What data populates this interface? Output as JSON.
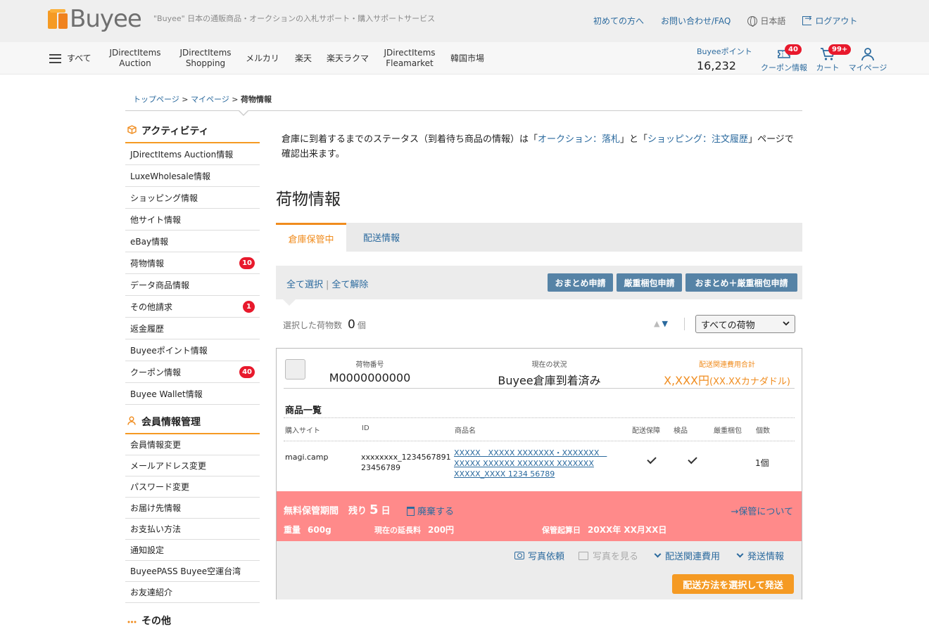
{
  "header": {
    "logo_text": "Buyee",
    "tagline": "\"Buyee\" 日本の通販商品・オークションの入札サポート・購入サポートサービス",
    "links": [
      "初めての方へ",
      "お問い合わせ/FAQ",
      "日本語",
      "ログアウト"
    ]
  },
  "nav": {
    "all_label": "すべて",
    "items": [
      {
        "l1": "JDirectItems",
        "l2": "Auction"
      },
      {
        "l1": "JDirectItems",
        "l2": "Shopping"
      },
      {
        "l1": "メルカリ",
        "l2": ""
      },
      {
        "l1": "楽天",
        "l2": ""
      },
      {
        "l1": "楽天ラクマ",
        "l2": ""
      },
      {
        "l1": "JDirectItems",
        "l2": "Fleamarket"
      },
      {
        "l1": "韓国市場",
        "l2": ""
      }
    ],
    "points_label": "Buyeeポイント",
    "points_value": "16,232",
    "coupon_label": "クーポン情報",
    "coupon_badge": "40",
    "cart_label": "カート",
    "cart_badge": "99+",
    "mypage_label": "マイページ"
  },
  "breadcrumb": {
    "top": "トップページ",
    "mypage": "マイページ",
    "current": "荷物情報",
    "sep": ">"
  },
  "sidebar": {
    "activity_title": "アクティビティ",
    "activity_items": [
      {
        "label": "JDirectItems Auction情報",
        "badge": ""
      },
      {
        "label": "LuxeWholesale情報",
        "badge": ""
      },
      {
        "label": "ショッピング情報",
        "badge": ""
      },
      {
        "label": "他サイト情報",
        "badge": ""
      },
      {
        "label": "eBay情報",
        "badge": ""
      },
      {
        "label": "荷物情報",
        "badge": "10"
      },
      {
        "label": "データ商品情報",
        "badge": ""
      },
      {
        "label": "その他請求",
        "badge": "1"
      },
      {
        "label": "返金履歴",
        "badge": ""
      },
      {
        "label": "Buyeeポイント情報",
        "badge": ""
      },
      {
        "label": "クーポン情報",
        "badge": "40"
      },
      {
        "label": "Buyee Wallet情報",
        "badge": ""
      }
    ],
    "member_title": "会員情報管理",
    "member_items": [
      "会員情報変更",
      "メールアドレス変更",
      "パスワード変更",
      "お届け先情報",
      "お支払い方法",
      "通知設定",
      "BuyeePASS Buyee空運台湾",
      "お友達紹介"
    ],
    "other_title": "その他"
  },
  "intro": {
    "p1": "倉庫に到着するまでのステータス（到着待ち商品の情報）は「",
    "link1": "オークション：落札",
    "p2": "」と「",
    "link2": "ショッピング：注文履歴",
    "p3": "」ページで確認出来ます。"
  },
  "page_title": "荷物情報",
  "tabs": {
    "active": "倉庫保管中",
    "inactive": "配送情報"
  },
  "actions": {
    "select_all": "全て選択",
    "sep": "|",
    "deselect_all": "全て解除",
    "btn_combine": "おまとめ申請",
    "btn_packing": "厳重梱包申請",
    "btn_both": "おまとめ＋厳重梱包申請"
  },
  "count": {
    "label": "選択した荷物数",
    "value": "0",
    "unit": "個"
  },
  "filter": {
    "selected": "すべての荷物"
  },
  "package": {
    "number_label": "荷物番号",
    "number_value": "M0000000000",
    "status_label": "現在の状況",
    "status_value": "Buyee倉庫到着済み",
    "fee_label": "配送関連費用合計",
    "fee_value": "X,XXX円",
    "fee_sub": "(XX.XXカナダドル)",
    "list_title": "商品一覧",
    "columns": [
      "購入サイト",
      "ID",
      "商品名",
      "配送保障",
      "検品",
      "厳重梱包",
      "個数"
    ],
    "item": {
      "site": "magi.camp",
      "id_line1": "xxxxxxxx_1234567891",
      "id_line2": "23456789",
      "name_line1": "XXXXX　XXXXX XXXXXXX・XXXXXXX　",
      "name_line2": "XXXXX XXXXXX XXXXXXX XXXXXXX",
      "name_line3": "XXXXX_XXXX 1234 56789",
      "qty": "1個"
    },
    "storage": {
      "free_label": "無料保管期間",
      "remain_label": "残り",
      "remain_value": "5",
      "remain_unit": "日",
      "dispose": "廃棄する",
      "about": "→保管について",
      "weight_label": "重量",
      "weight_value": "600g",
      "ext_label": "現在の延長料",
      "ext_value": "200円",
      "start_label": "保管起算日",
      "start_value": "20XX年 XX月XX日"
    },
    "footer": {
      "photo_request": "写真依頼",
      "photo_view": "写真を見る",
      "shipping_fee": "配送関連費用",
      "ship_info": "発送情報",
      "ship_button": "配送方法を選択して発送"
    }
  },
  "colors": {
    "accent_orange": "#f59a23",
    "link_blue": "#2b6a9e",
    "badge_red": "#e8192c",
    "storage_bg": "#ff8a8a",
    "action_btn": "#5683a6"
  }
}
